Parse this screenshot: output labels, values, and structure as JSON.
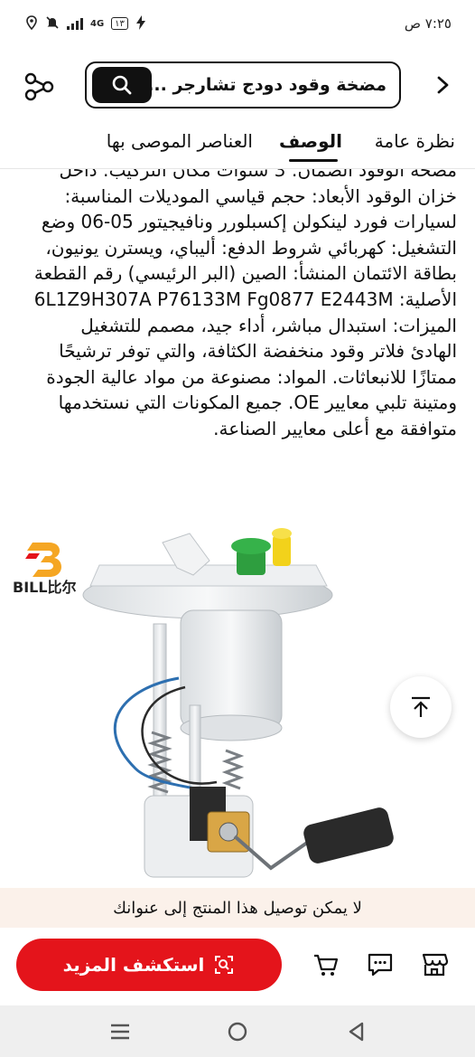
{
  "status_bar": {
    "time": "٧:٢٥ ص",
    "network": "4G",
    "battery": "١٣"
  },
  "header": {
    "search_text": "مضخة وقود دودج تشارجر ...2",
    "icons": {
      "share": "share-icon",
      "search": "search-icon",
      "back": "chevron-right-icon"
    }
  },
  "tabs": [
    {
      "label": "نظرة عامة",
      "active": false
    },
    {
      "label": "الوصف",
      "active": true
    },
    {
      "label": "العناصر الموصى بها",
      "active": false
    }
  ],
  "description": "مضخة الوقود الضمان: 3 سنوات مكان التركيب: داخل خزان الوقود الأبعاد: حجم قياسي الموديلات المناسبة: لسيارات فورد لينكولن إكسبلورر ونافيجيتور 05-06 وضع التشغيل: كهربائي شروط الدفع: أليباي، ويسترن يونيون، بطاقة الائتمان المنشأ: الصين (البر الرئيسي) رقم القطعة الأصلية: 6L1Z9H307A P76133M Fg0877 E2443M الميزات: استبدال مباشر، أداء جيد، مصمم للتشغيل الهادئ فلاتر وقود منخفضة الكثافة، والتي توفر ترشيحًا ممتازًا للانبعاثات. المواد: مصنوعة من مواد عالية الجودة ومتينة تلبي معايير OE. جميع المكونات التي نستخدمها متوافقة مع أعلى معايير الصناعة.",
  "product": {
    "brand": "BILL比尔"
  },
  "notice": "لا يمكن توصيل هذا المنتج إلى عنوانك",
  "actions": {
    "explore_label": "استكشف المزيد",
    "accent_color": "#e4141b"
  }
}
